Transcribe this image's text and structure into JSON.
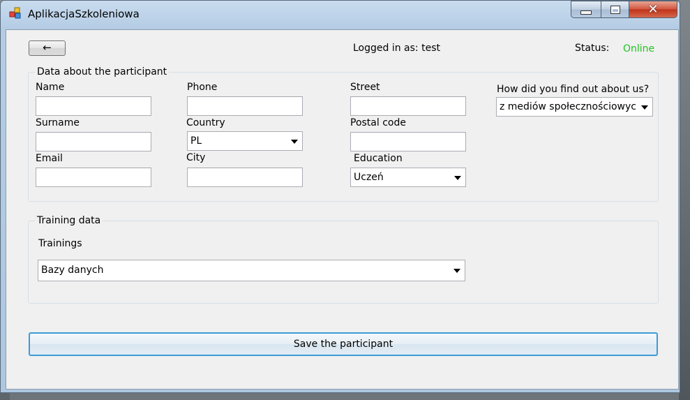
{
  "window": {
    "title": "AplikacjaSzkoleniowa"
  },
  "header": {
    "back_label": "←",
    "logged_in": "Logged in as: test",
    "status_label": "Status:",
    "status_value": "Online",
    "status_color": "#22c322"
  },
  "participant": {
    "group_title": "Data about the participant",
    "name_label": "Name",
    "surname_label": "Surname",
    "email_label": "Email",
    "phone_label": "Phone",
    "country_label": "Country",
    "country_value": "PL",
    "city_label": "City",
    "street_label": "Street",
    "postal_label": "Postal code",
    "education_label": "Education",
    "education_value": "Uczeń",
    "source_label": "How did you find out about us?",
    "source_value": "z mediów społecznościowych"
  },
  "training": {
    "group_title": "Training data",
    "trainings_label": "Trainings",
    "trainings_value": "Bazy danych"
  },
  "save_label": "Save the participant",
  "icons": [
    "app-icon",
    "minimize-icon",
    "maximize-icon",
    "close-icon",
    "dropdown-arrow-icon"
  ]
}
